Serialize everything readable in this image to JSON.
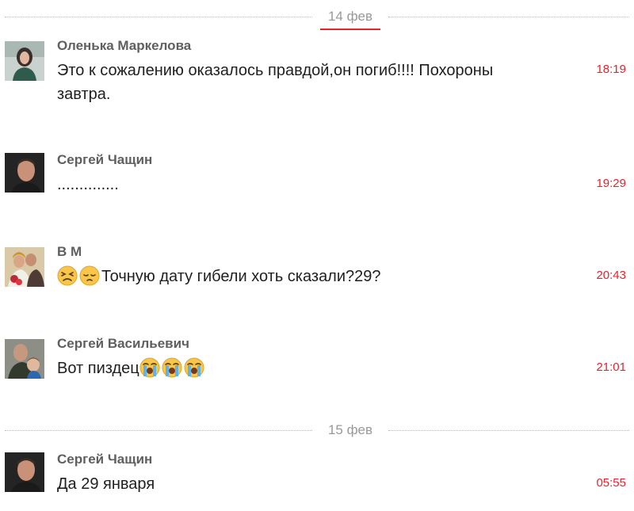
{
  "date_separators": [
    "14 фев",
    "15 фев"
  ],
  "messages": [
    {
      "author": "Оленька Маркелова",
      "text": "Это к сожалению оказалось правдой,он погиб!!!! Похороны завтра.",
      "time": "18:19"
    },
    {
      "author": "Сергей Чащин",
      "text": "..............",
      "time": "19:29"
    },
    {
      "author": "В М",
      "text": "Точную дату гибели хоть сказали?29?",
      "emojis": [
        "persevering-face-icon",
        "pensive-face-icon"
      ],
      "time": "20:43"
    },
    {
      "author": "Сергей Васильевич",
      "text": "Вот пиздец",
      "emojis": [
        "loudly-crying-face-icon",
        "loudly-crying-face-icon",
        "loudly-crying-face-icon"
      ],
      "time": "21:01"
    },
    {
      "author": "Сергей Чащин",
      "text": "Да 29 января",
      "time": "05:55"
    }
  ],
  "colors": {
    "accent": "#e5242b",
    "author": "#5f5f5f",
    "text": "#1f1f1f",
    "separator": "#999999"
  }
}
